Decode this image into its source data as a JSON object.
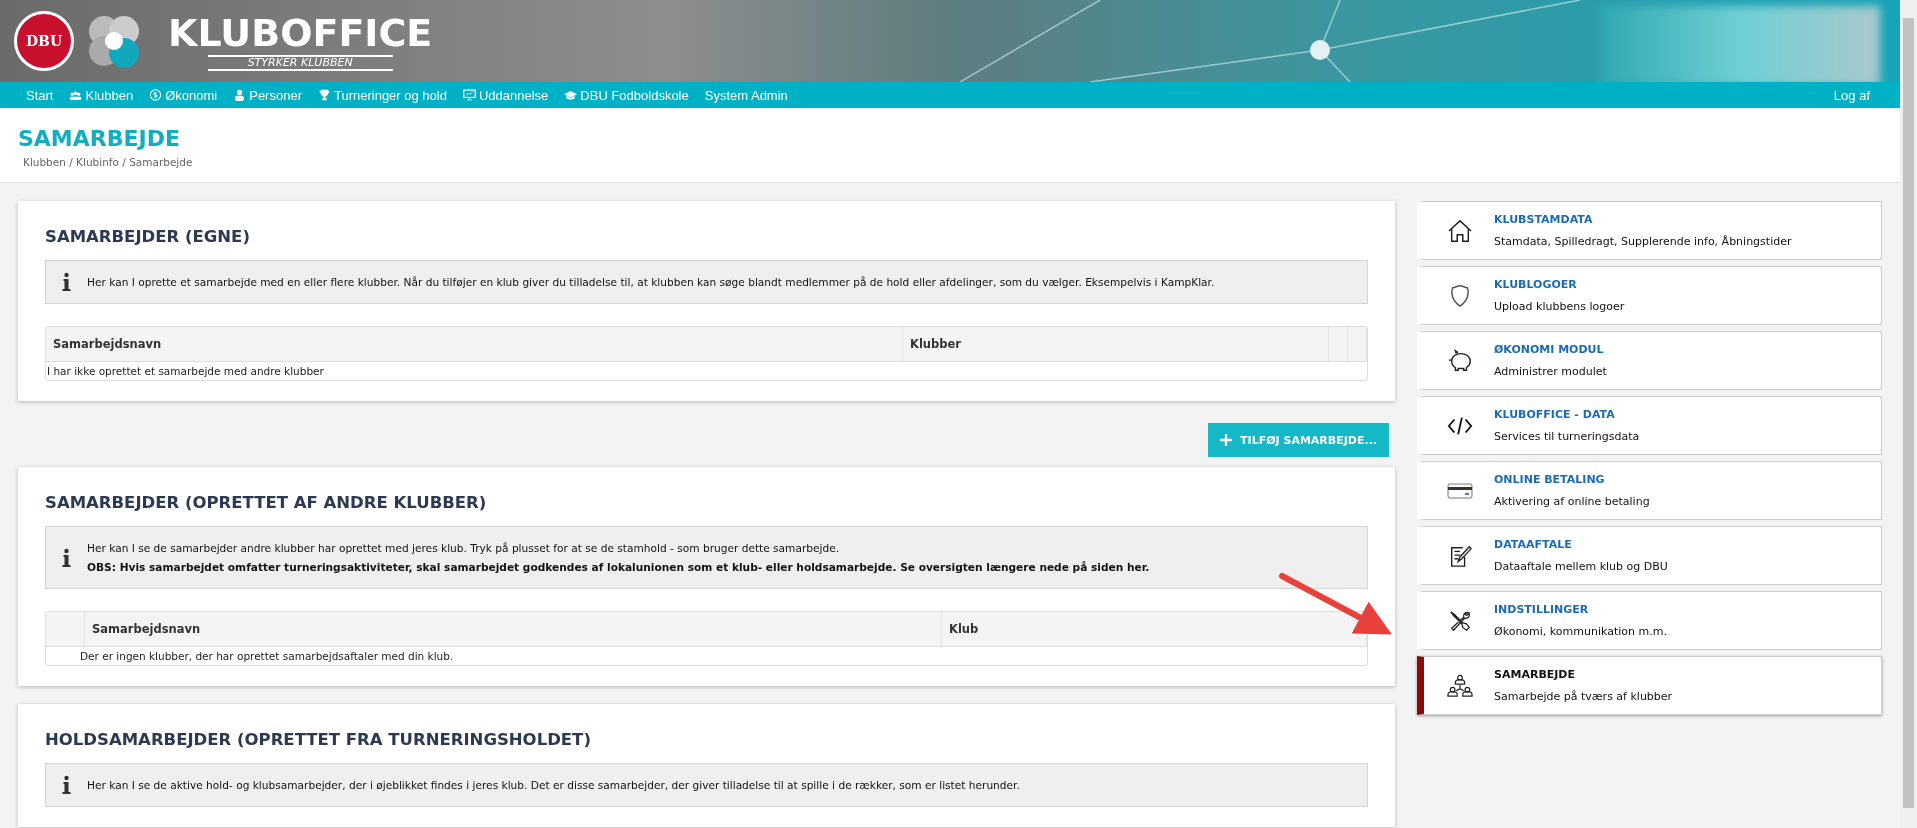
{
  "header": {
    "logo_text": "DBU",
    "brand": "KLUBOFFICE",
    "tagline": "STYRKER KLUBBEN"
  },
  "nav": {
    "items": [
      {
        "label": "Start",
        "kind": "plain"
      },
      {
        "label": "Klubben",
        "kind": "people"
      },
      {
        "label": "Økonomi",
        "kind": "coin"
      },
      {
        "label": "Personer",
        "kind": "person"
      },
      {
        "label": "Turneringer og hold",
        "kind": "trophy"
      },
      {
        "label": "Uddannelse",
        "kind": "board"
      },
      {
        "label": "DBU Fodboldskole",
        "kind": "cap"
      },
      {
        "label": "System Admin",
        "kind": "plain"
      }
    ],
    "logout": "Log af"
  },
  "page": {
    "title": "SAMARBEJDE",
    "breadcrumb": "Klubben / Klubinfo / Samarbejde"
  },
  "sections": [
    {
      "title": "SAMARBEJDER (EGNE)",
      "info": [
        {
          "kind": "plain",
          "text": "Her kan I oprette et samarbejde med en eller flere klubber. Når du tilføjer en klub giver du tilladelse til, at klubben kan søge blandt medlemmer på de hold eller afdelinger, som du vælger. Eksempelvis i KampKlar."
        }
      ],
      "table": {
        "kind": "trailing-blanks",
        "columns": [
          "Samarbejdsnavn",
          "Klubber"
        ],
        "empty_message": "I har ikke oprettet et samarbejde med andre klubber"
      },
      "button": "TILFØJ SAMARBEJDE..."
    },
    {
      "title": "SAMARBEJDER (OPRETTET AF ANDRE KLUBBER)",
      "info": [
        {
          "kind": "plain",
          "text": "Her kan I se de samarbejder andre klubber har oprettet med jeres klub. Tryk på plusset for at se de stamhold - som bruger dette samarbejde."
        },
        {
          "kind": "note",
          "text": "OBS: Hvis samarbejdet omfatter turneringsaktiviteter, skal samarbejdet godkendes af lokalunionen som et klub- eller holdsamarbejde. Se oversigten længere nede på siden her."
        }
      ],
      "table": {
        "kind": "leading-blank",
        "columns": [
          "Samarbejdsnavn",
          "Klub"
        ],
        "empty_message": "Der er ingen klubber, der har oprettet samarbejdsaftaler med din klub."
      }
    },
    {
      "title": "HOLDSAMARBEJDER (OPRETTET FRA TURNERINGSHOLDET)",
      "info": [
        {
          "kind": "plain",
          "text": "Her kan I se de aktive hold- og klubsamarbejder, der i øjeblikket findes i jeres klub. Det er disse samarbejder, der giver tilladelse til at spille i de rækker, som er listet herunder."
        }
      ]
    }
  ],
  "sidebar": {
    "items": [
      {
        "kind": "house",
        "title": "KLUBSTAMDATA",
        "subtitle": "Stamdata, Spilledragt, Supplerende info, Åbningstider",
        "selected": false
      },
      {
        "kind": "shield",
        "title": "KLUBLOGOER",
        "subtitle": "Upload klubbens logoer",
        "selected": false
      },
      {
        "kind": "piggy",
        "title": "ØKONOMI MODUL",
        "subtitle": "Administrer modulet",
        "selected": false
      },
      {
        "kind": "code",
        "title": "KLUBOFFICE - DATA",
        "subtitle": "Services til turneringsdata",
        "selected": false
      },
      {
        "kind": "card",
        "title": "ONLINE BETALING",
        "subtitle": "Aktivering af online betaling",
        "selected": false
      },
      {
        "kind": "edit",
        "title": "DATAAFTALE",
        "subtitle": "Dataaftale mellem klub og DBU",
        "selected": false
      },
      {
        "kind": "tools",
        "title": "INDSTILLINGER",
        "subtitle": "Økonomi, kommunikation m.m.",
        "selected": false
      },
      {
        "kind": "network",
        "title": "SAMARBEJDE",
        "subtitle": "Samarbejde på tværs af klubber",
        "selected": true
      }
    ]
  }
}
